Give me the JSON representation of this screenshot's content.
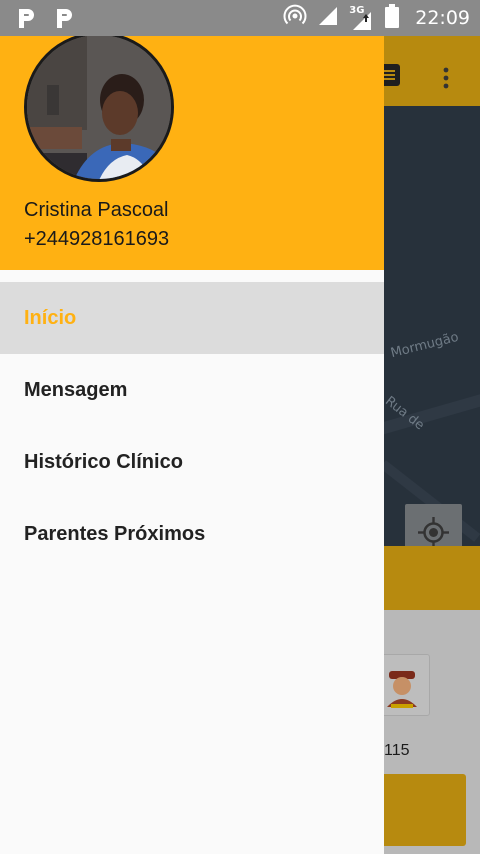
{
  "status_bar": {
    "time": "22:09",
    "network_label": "3G",
    "icons": [
      "p-notification-icon",
      "p-notification-icon",
      "hotspot-icon",
      "signal-icon",
      "network-3g-icon",
      "battery-icon"
    ]
  },
  "background": {
    "street_labels": [
      "Mormugão",
      "Rua de"
    ],
    "number": "115"
  },
  "drawer": {
    "user": {
      "name": "Cristina Pascoal",
      "phone": "+244928161693"
    },
    "menu": [
      {
        "label": "Início",
        "active": true
      },
      {
        "label": "Mensagem",
        "active": false
      },
      {
        "label": "Histórico Clínico",
        "active": false
      },
      {
        "label": "Parentes Próximos",
        "active": false
      }
    ]
  },
  "colors": {
    "accent": "#ffb112",
    "status_bar": "#8a8a8a",
    "drawer_bg": "#fafafa",
    "active_item_bg": "#dcdcdc"
  }
}
